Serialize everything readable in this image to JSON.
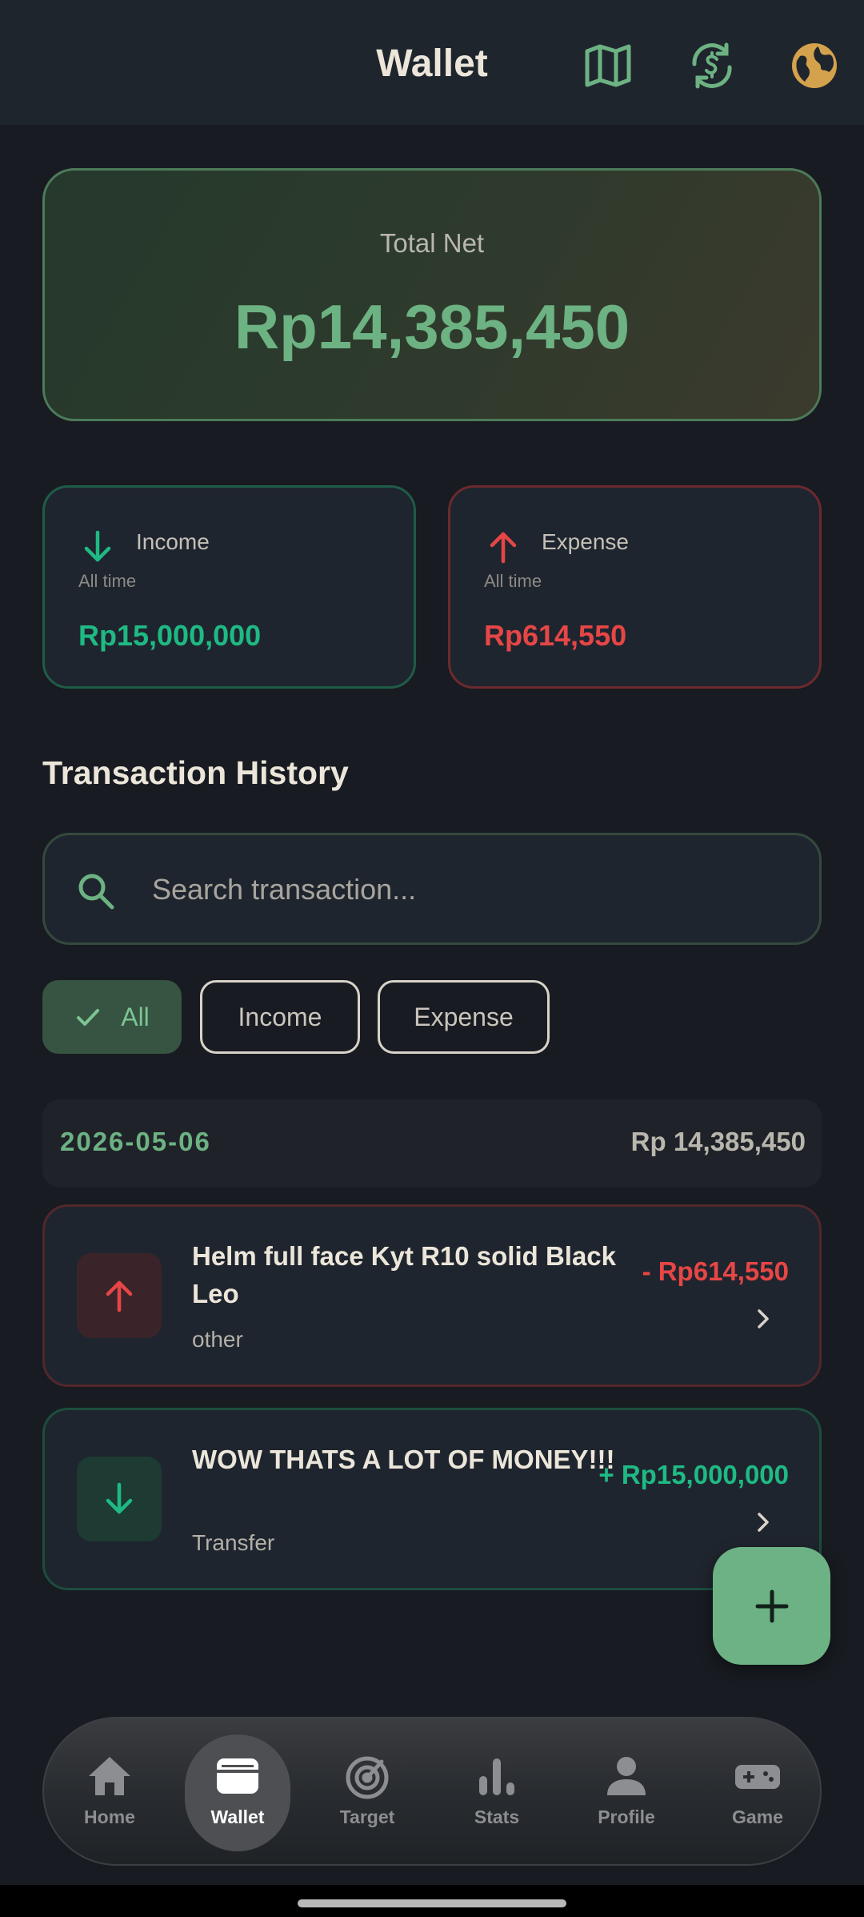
{
  "app_bar": {
    "title": "Wallet",
    "icons": [
      "map-icon",
      "currency-exchange-icon",
      "globe-icon"
    ]
  },
  "total_net": {
    "label": "Total Net",
    "value": "Rp14,385,450"
  },
  "summary": {
    "income": {
      "title": "Income",
      "subtitle": "All time",
      "value": "Rp15,000,000",
      "icon": "arrow-down-icon"
    },
    "expense": {
      "title": "Expense",
      "subtitle": "All time",
      "value": "Rp614,550",
      "icon": "arrow-up-icon"
    }
  },
  "history": {
    "title": "Transaction History",
    "search_placeholder": "Search transaction...",
    "filters": [
      {
        "label": "All",
        "selected": true
      },
      {
        "label": "Income",
        "selected": false
      },
      {
        "label": "Expense",
        "selected": false
      }
    ],
    "groups": [
      {
        "date": "2026-05-06",
        "total": "Rp 14,385,450",
        "transactions": [
          {
            "title": "Helm full face Kyt R10 solid Black Leo",
            "category": "other",
            "amount": "- Rp614,550",
            "type": "expense"
          },
          {
            "title": "WOW THATS A LOT OF MONEY!!!",
            "category": "Transfer",
            "amount": "+ Rp15,000,000",
            "type": "income"
          }
        ]
      }
    ]
  },
  "fab": {
    "icon": "plus-icon"
  },
  "bottom_nav": {
    "items": [
      {
        "label": "Home",
        "icon": "home-icon",
        "active": false
      },
      {
        "label": "Wallet",
        "icon": "wallet-icon",
        "active": true
      },
      {
        "label": "Target",
        "icon": "target-icon",
        "active": false
      },
      {
        "label": "Stats",
        "icon": "stats-icon",
        "active": false
      },
      {
        "label": "Profile",
        "icon": "profile-icon",
        "active": false
      },
      {
        "label": "Game",
        "icon": "gamepad-icon",
        "active": false
      }
    ]
  },
  "colors": {
    "accent_green": "#6db282",
    "income_green": "#1fba84",
    "expense_red": "#e64646",
    "background": "#181b21",
    "surface": "#1f252e"
  }
}
